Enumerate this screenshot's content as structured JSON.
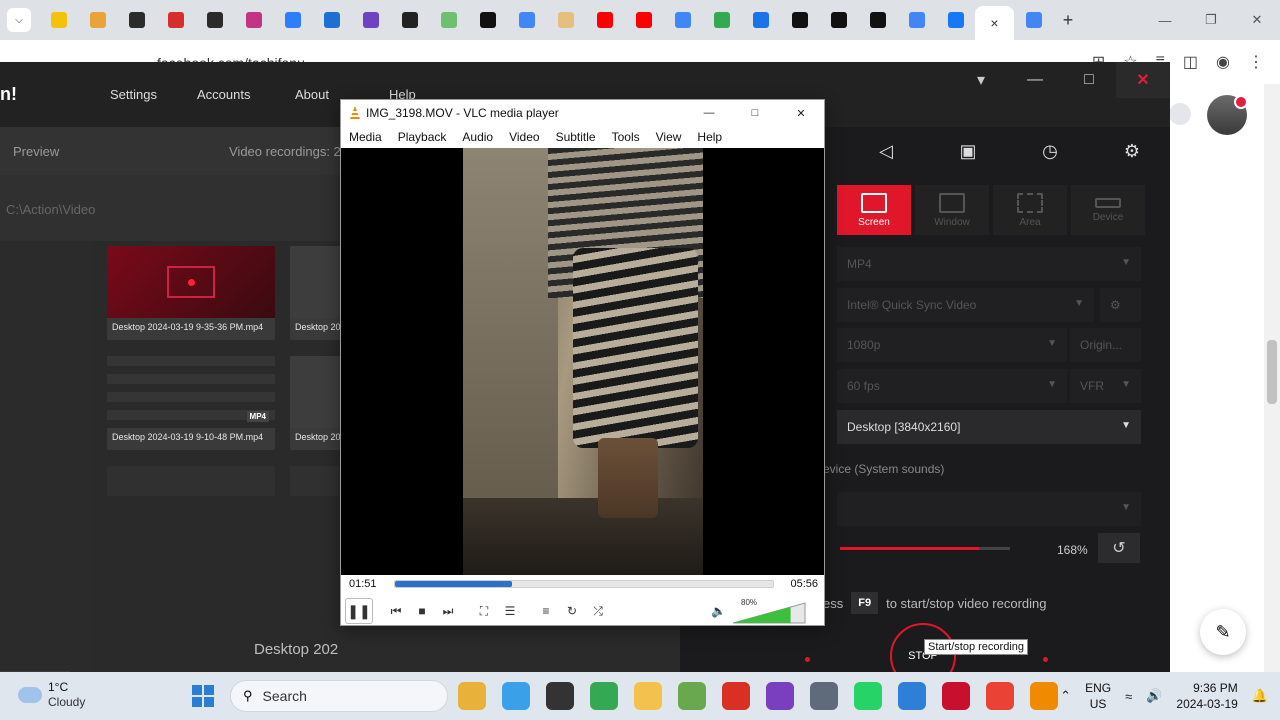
{
  "browser": {
    "address": "facebook.com/tachifanu",
    "tab_favicons": [
      "#f4c20d",
      "#e8a33d",
      "#2b2b2b",
      "#d62d2d",
      "#2b2b2b",
      "#c13584",
      "#2d7ff9",
      "#1f6fd1",
      "#6f42c1",
      "#222222",
      "#6fbf73",
      "#111111",
      "#4285f4",
      "#e5c07b",
      "#ff0000",
      "#ff0000",
      "#4285f4",
      "#34a853",
      "#1a73e8",
      "#111111",
      "#111111",
      "#111111",
      "#4285f4",
      "#1877f2"
    ],
    "active_tab_close": "×",
    "new_tab": "+"
  },
  "action": {
    "title": "n!",
    "nav": [
      "Settings",
      "Accounts",
      "About",
      "Help"
    ],
    "preview_label": "Preview",
    "recordings_label": "Video recordings: 2",
    "path": "C:\\Action\\Video",
    "thumbs": [
      {
        "caption": "Desktop 2024-03-19 9-35-36 PM.mp4"
      },
      {
        "caption": "Desktop 20"
      },
      {
        "caption": "Desktop 2024-03-19 9-10-48 PM.mp4"
      },
      {
        "caption": "Desktop 20"
      }
    ],
    "big_label": "Desktop 202",
    "modes": [
      "Screen",
      "Window",
      "Area",
      "Device"
    ],
    "format": "MP4",
    "encoder": "Intel® Quick Sync Video",
    "resolution": "1080p",
    "res_mode": "Origin...",
    "fps": "60 fps",
    "fps_mode": "VFR",
    "source": "Desktop [3840x2160]",
    "audio_device": "evice (System sounds)",
    "volume_pct": "168%",
    "volume_level": 0.82,
    "hint_prefix": "ess",
    "hotkey": "F9",
    "hint_text": "to start/stop video recording",
    "stop_label": "STOP",
    "tooltip": "Start/stop recording"
  },
  "vlc": {
    "title": "IMG_3198.MOV - VLC media player",
    "menu": [
      "Media",
      "Playback",
      "Audio",
      "Video",
      "Subtitle",
      "Tools",
      "View",
      "Help"
    ],
    "current_time": "01:51",
    "total_time": "05:56",
    "progress": 0.31,
    "volume": "80%"
  },
  "taskbar": {
    "temp": "1°C",
    "weather": "Cloudy",
    "search_placeholder": "Search",
    "apps": [
      {
        "name": "chrome-canary",
        "color": "#e8b23a"
      },
      {
        "name": "copilot",
        "color": "#3aa0e8"
      },
      {
        "name": "task-view",
        "color": "#333333"
      },
      {
        "name": "chrome",
        "color": "#34a853"
      },
      {
        "name": "file-explorer",
        "color": "#f2c14e"
      },
      {
        "name": "utorrent",
        "color": "#6aa84f"
      },
      {
        "name": "acrobat",
        "color": "#d93025"
      },
      {
        "name": "media-app",
        "color": "#7a3fbf"
      },
      {
        "name": "settings",
        "color": "#5f6b7a"
      },
      {
        "name": "whatsapp",
        "color": "#25d366"
      },
      {
        "name": "photos",
        "color": "#2f7ed8"
      },
      {
        "name": "action-app",
        "color": "#c8102e"
      },
      {
        "name": "chrome-profile",
        "color": "#ea4335"
      },
      {
        "name": "vlc",
        "color": "#f08a00"
      }
    ],
    "lang_line1": "ENG",
    "lang_line2": "US",
    "time": "9:36 PM",
    "date": "2024-03-19"
  }
}
